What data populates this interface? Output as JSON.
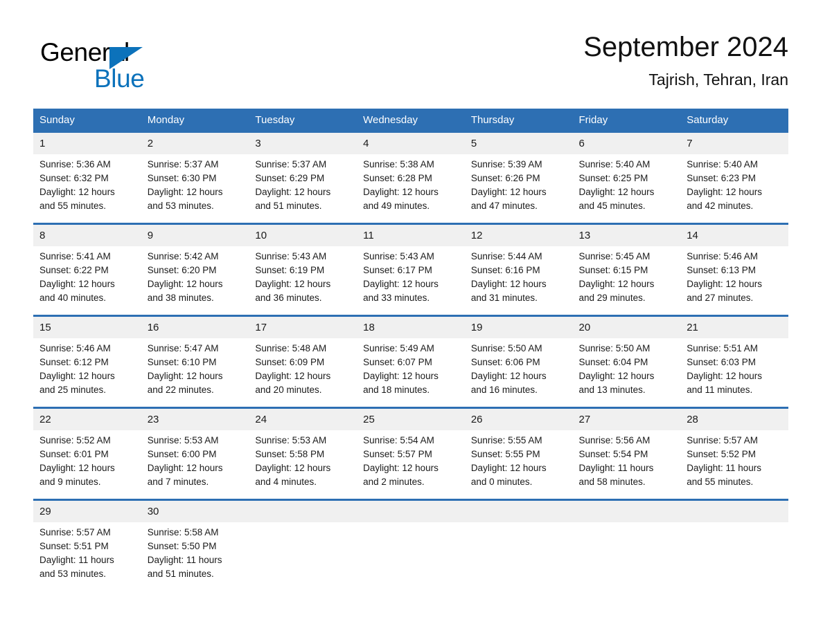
{
  "brand": {
    "name_part1": "General",
    "name_part2": "Blue",
    "accent_color": "#0c72bb",
    "triangle_icon": "brand-triangle-icon"
  },
  "header": {
    "title": "September 2024",
    "subtitle": "Tajrish, Tehran, Iran"
  },
  "theme": {
    "header_blue": "#2d6fb3",
    "daynum_band": "#f0f0f0",
    "text": "#1a1a1a"
  },
  "weekdays": [
    "Sunday",
    "Monday",
    "Tuesday",
    "Wednesday",
    "Thursday",
    "Friday",
    "Saturday"
  ],
  "weeks": [
    {
      "days": [
        {
          "num": "1",
          "sunrise": "Sunrise: 5:36 AM",
          "sunset": "Sunset: 6:32 PM",
          "daylight1": "Daylight: 12 hours",
          "daylight2": "and 55 minutes."
        },
        {
          "num": "2",
          "sunrise": "Sunrise: 5:37 AM",
          "sunset": "Sunset: 6:30 PM",
          "daylight1": "Daylight: 12 hours",
          "daylight2": "and 53 minutes."
        },
        {
          "num": "3",
          "sunrise": "Sunrise: 5:37 AM",
          "sunset": "Sunset: 6:29 PM",
          "daylight1": "Daylight: 12 hours",
          "daylight2": "and 51 minutes."
        },
        {
          "num": "4",
          "sunrise": "Sunrise: 5:38 AM",
          "sunset": "Sunset: 6:28 PM",
          "daylight1": "Daylight: 12 hours",
          "daylight2": "and 49 minutes."
        },
        {
          "num": "5",
          "sunrise": "Sunrise: 5:39 AM",
          "sunset": "Sunset: 6:26 PM",
          "daylight1": "Daylight: 12 hours",
          "daylight2": "and 47 minutes."
        },
        {
          "num": "6",
          "sunrise": "Sunrise: 5:40 AM",
          "sunset": "Sunset: 6:25 PM",
          "daylight1": "Daylight: 12 hours",
          "daylight2": "and 45 minutes."
        },
        {
          "num": "7",
          "sunrise": "Sunrise: 5:40 AM",
          "sunset": "Sunset: 6:23 PM",
          "daylight1": "Daylight: 12 hours",
          "daylight2": "and 42 minutes."
        }
      ]
    },
    {
      "days": [
        {
          "num": "8",
          "sunrise": "Sunrise: 5:41 AM",
          "sunset": "Sunset: 6:22 PM",
          "daylight1": "Daylight: 12 hours",
          "daylight2": "and 40 minutes."
        },
        {
          "num": "9",
          "sunrise": "Sunrise: 5:42 AM",
          "sunset": "Sunset: 6:20 PM",
          "daylight1": "Daylight: 12 hours",
          "daylight2": "and 38 minutes."
        },
        {
          "num": "10",
          "sunrise": "Sunrise: 5:43 AM",
          "sunset": "Sunset: 6:19 PM",
          "daylight1": "Daylight: 12 hours",
          "daylight2": "and 36 minutes."
        },
        {
          "num": "11",
          "sunrise": "Sunrise: 5:43 AM",
          "sunset": "Sunset: 6:17 PM",
          "daylight1": "Daylight: 12 hours",
          "daylight2": "and 33 minutes."
        },
        {
          "num": "12",
          "sunrise": "Sunrise: 5:44 AM",
          "sunset": "Sunset: 6:16 PM",
          "daylight1": "Daylight: 12 hours",
          "daylight2": "and 31 minutes."
        },
        {
          "num": "13",
          "sunrise": "Sunrise: 5:45 AM",
          "sunset": "Sunset: 6:15 PM",
          "daylight1": "Daylight: 12 hours",
          "daylight2": "and 29 minutes."
        },
        {
          "num": "14",
          "sunrise": "Sunrise: 5:46 AM",
          "sunset": "Sunset: 6:13 PM",
          "daylight1": "Daylight: 12 hours",
          "daylight2": "and 27 minutes."
        }
      ]
    },
    {
      "days": [
        {
          "num": "15",
          "sunrise": "Sunrise: 5:46 AM",
          "sunset": "Sunset: 6:12 PM",
          "daylight1": "Daylight: 12 hours",
          "daylight2": "and 25 minutes."
        },
        {
          "num": "16",
          "sunrise": "Sunrise: 5:47 AM",
          "sunset": "Sunset: 6:10 PM",
          "daylight1": "Daylight: 12 hours",
          "daylight2": "and 22 minutes."
        },
        {
          "num": "17",
          "sunrise": "Sunrise: 5:48 AM",
          "sunset": "Sunset: 6:09 PM",
          "daylight1": "Daylight: 12 hours",
          "daylight2": "and 20 minutes."
        },
        {
          "num": "18",
          "sunrise": "Sunrise: 5:49 AM",
          "sunset": "Sunset: 6:07 PM",
          "daylight1": "Daylight: 12 hours",
          "daylight2": "and 18 minutes."
        },
        {
          "num": "19",
          "sunrise": "Sunrise: 5:50 AM",
          "sunset": "Sunset: 6:06 PM",
          "daylight1": "Daylight: 12 hours",
          "daylight2": "and 16 minutes."
        },
        {
          "num": "20",
          "sunrise": "Sunrise: 5:50 AM",
          "sunset": "Sunset: 6:04 PM",
          "daylight1": "Daylight: 12 hours",
          "daylight2": "and 13 minutes."
        },
        {
          "num": "21",
          "sunrise": "Sunrise: 5:51 AM",
          "sunset": "Sunset: 6:03 PM",
          "daylight1": "Daylight: 12 hours",
          "daylight2": "and 11 minutes."
        }
      ]
    },
    {
      "days": [
        {
          "num": "22",
          "sunrise": "Sunrise: 5:52 AM",
          "sunset": "Sunset: 6:01 PM",
          "daylight1": "Daylight: 12 hours",
          "daylight2": "and 9 minutes."
        },
        {
          "num": "23",
          "sunrise": "Sunrise: 5:53 AM",
          "sunset": "Sunset: 6:00 PM",
          "daylight1": "Daylight: 12 hours",
          "daylight2": "and 7 minutes."
        },
        {
          "num": "24",
          "sunrise": "Sunrise: 5:53 AM",
          "sunset": "Sunset: 5:58 PM",
          "daylight1": "Daylight: 12 hours",
          "daylight2": "and 4 minutes."
        },
        {
          "num": "25",
          "sunrise": "Sunrise: 5:54 AM",
          "sunset": "Sunset: 5:57 PM",
          "daylight1": "Daylight: 12 hours",
          "daylight2": "and 2 minutes."
        },
        {
          "num": "26",
          "sunrise": "Sunrise: 5:55 AM",
          "sunset": "Sunset: 5:55 PM",
          "daylight1": "Daylight: 12 hours",
          "daylight2": "and 0 minutes."
        },
        {
          "num": "27",
          "sunrise": "Sunrise: 5:56 AM",
          "sunset": "Sunset: 5:54 PM",
          "daylight1": "Daylight: 11 hours",
          "daylight2": "and 58 minutes."
        },
        {
          "num": "28",
          "sunrise": "Sunrise: 5:57 AM",
          "sunset": "Sunset: 5:52 PM",
          "daylight1": "Daylight: 11 hours",
          "daylight2": "and 55 minutes."
        }
      ]
    },
    {
      "days": [
        {
          "num": "29",
          "sunrise": "Sunrise: 5:57 AM",
          "sunset": "Sunset: 5:51 PM",
          "daylight1": "Daylight: 11 hours",
          "daylight2": "and 53 minutes."
        },
        {
          "num": "30",
          "sunrise": "Sunrise: 5:58 AM",
          "sunset": "Sunset: 5:50 PM",
          "daylight1": "Daylight: 11 hours",
          "daylight2": "and 51 minutes."
        },
        {
          "num": "",
          "sunrise": "",
          "sunset": "",
          "daylight1": "",
          "daylight2": ""
        },
        {
          "num": "",
          "sunrise": "",
          "sunset": "",
          "daylight1": "",
          "daylight2": ""
        },
        {
          "num": "",
          "sunrise": "",
          "sunset": "",
          "daylight1": "",
          "daylight2": ""
        },
        {
          "num": "",
          "sunrise": "",
          "sunset": "",
          "daylight1": "",
          "daylight2": ""
        },
        {
          "num": "",
          "sunrise": "",
          "sunset": "",
          "daylight1": "",
          "daylight2": ""
        }
      ]
    }
  ]
}
